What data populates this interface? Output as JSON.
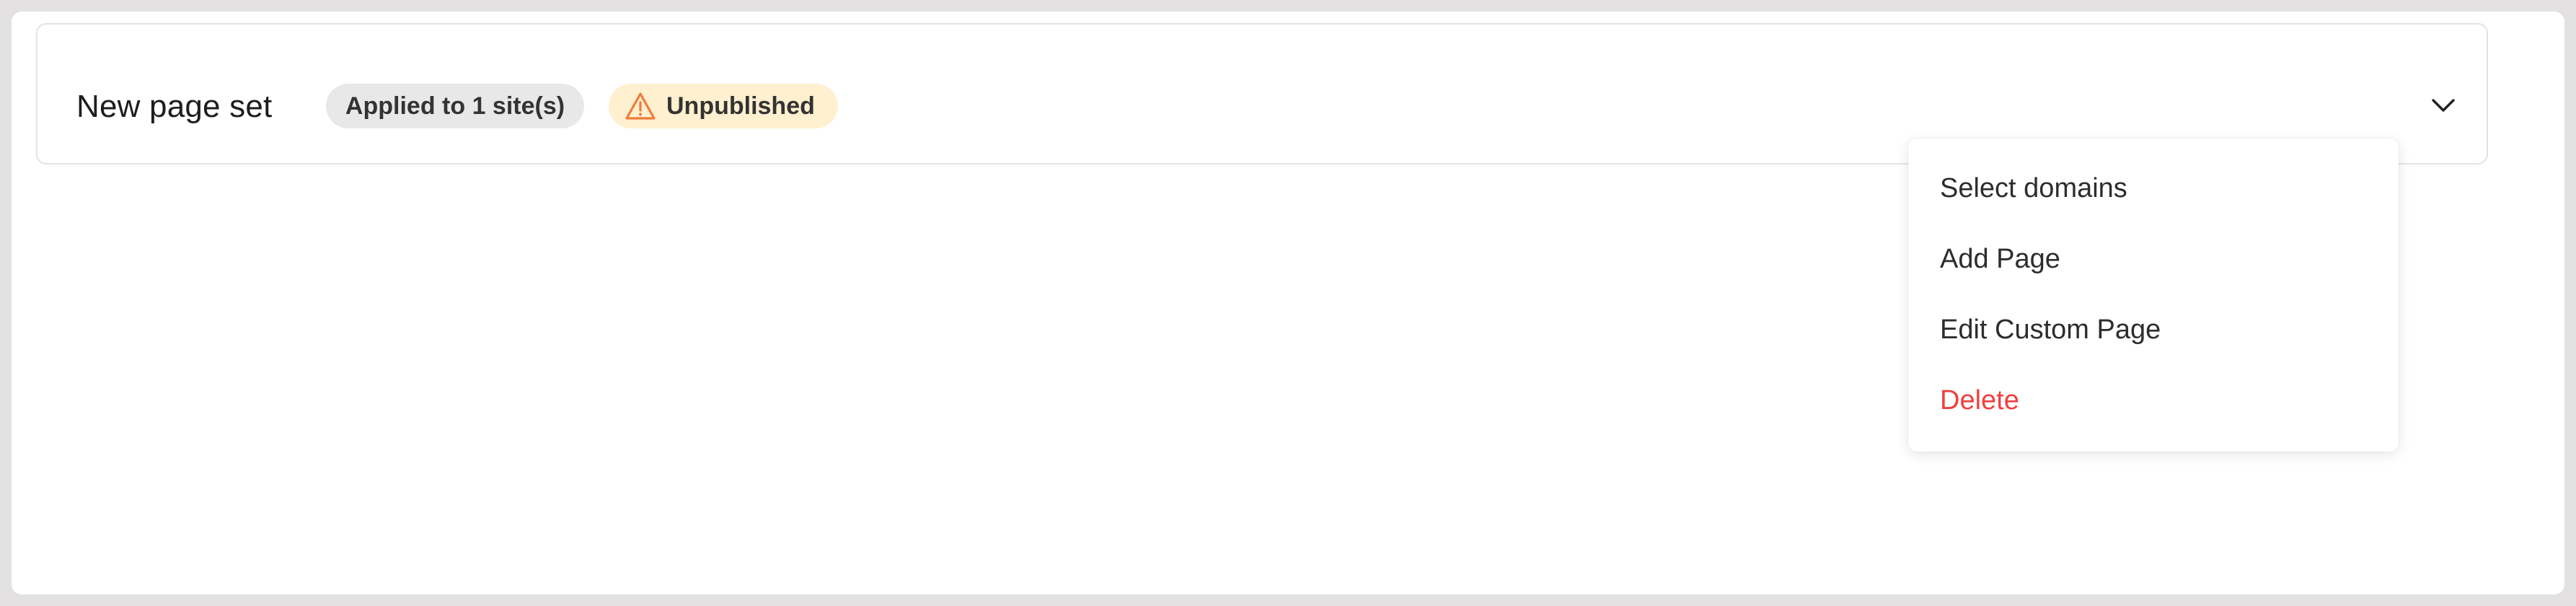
{
  "page_set": {
    "title": "New page set",
    "sites_badge": "Applied to 1 site(s)",
    "status_badge": "Unpublished",
    "status_icon": "warning-triangle-icon",
    "expand_icon": "chevron-down-icon"
  },
  "dropdown_menu": {
    "items": [
      {
        "label": "Select domains"
      },
      {
        "label": "Add Page"
      },
      {
        "label": "Edit Custom Page"
      },
      {
        "label": "Delete",
        "color": "#ef4040"
      }
    ]
  },
  "colors": {
    "status_badge_bg": "#fff0cf",
    "status_icon": "#f07c3c",
    "sites_badge_bg": "#e8e8e8",
    "danger": "#ef4040"
  }
}
